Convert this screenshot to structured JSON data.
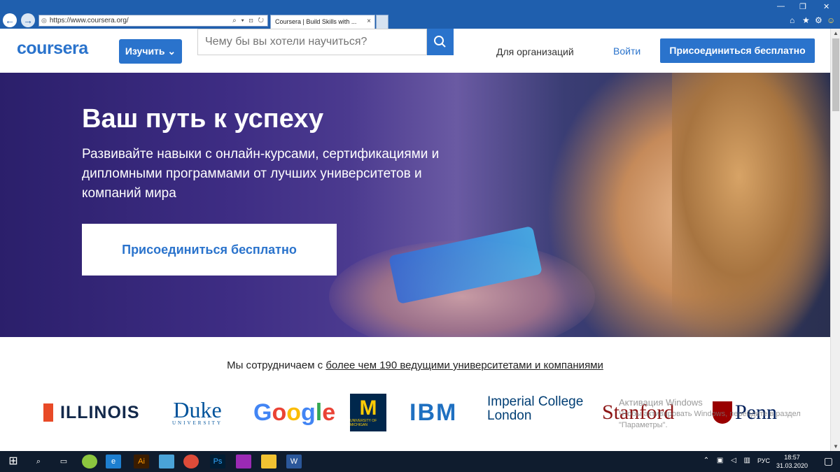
{
  "browser": {
    "url": "https://www.coursera.org/",
    "tab_title": "Coursera | Build Skills with ...",
    "tab_close": "×"
  },
  "header": {
    "logo": "coursera",
    "explore_label": "Изучить",
    "search_placeholder": "Чему бы вы хотели научиться?",
    "for_business": "Для организаций",
    "login": "Войти",
    "join": "Присоединиться бесплатно"
  },
  "hero": {
    "title": "Ваш путь к успеху",
    "subtitle": "Развивайте навыки с онлайн-курсами, сертификациями и дипломными программами от лучших университетов и компаний мира",
    "cta": "Присоединиться бесплатно"
  },
  "partners": {
    "text_prefix": "Мы сотрудничаем с ",
    "text_link": "более чем 190 ведущими университетами и компаниями",
    "logos": {
      "illinois": "ILLINOIS",
      "duke": "Duke",
      "duke_sub": "UNIVERSITY",
      "google": "Google",
      "michigan": "M",
      "michigan_sub": "UNIVERSITY OF MICHIGAN",
      "ibm": "IBM",
      "imperial_line1": "Imperial College",
      "imperial_line2": "London",
      "stanford": "Stanford",
      "penn": "Penn"
    }
  },
  "watermark": {
    "line1": "Активация Windows",
    "line2": "Чтобы активировать Windows, перейдите в раздел",
    "line3": "\"Параметры\"."
  },
  "taskbar": {
    "lang": "РУС",
    "time": "18:57",
    "date": "31.03.2020"
  },
  "colors": {
    "brand": "#2a73cc",
    "browser_chrome": "#1f5fae",
    "taskbar": "#0f1c2e"
  }
}
